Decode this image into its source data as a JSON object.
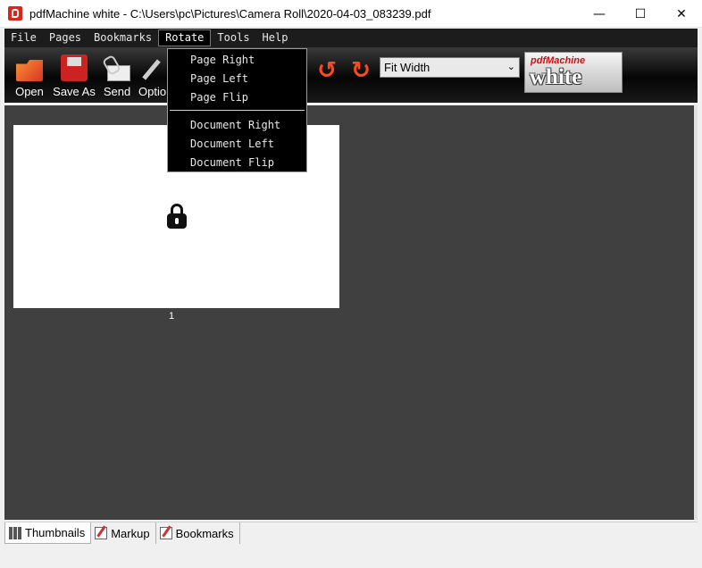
{
  "window": {
    "title": "pdfMachine white - C:\\Users\\pc\\Pictures\\Camera Roll\\2020-04-03_083239.pdf",
    "minimize": "—",
    "maximize": "☐",
    "close": "✕"
  },
  "menubar": {
    "items": [
      {
        "label": "File"
      },
      {
        "label": "Pages"
      },
      {
        "label": "Bookmarks"
      },
      {
        "label": "Rotate"
      },
      {
        "label": "Tools"
      },
      {
        "label": "Help"
      }
    ],
    "active": "Rotate"
  },
  "toolbar": {
    "open_label": "Open",
    "save_as_label": "Save As",
    "send_label": "Send",
    "options_label": "Options",
    "rotate_left_glyph": "↺",
    "rotate_right_glyph": "↻",
    "zoom_value": "Fit Width",
    "logo_top": "pdfMachine",
    "logo_bottom": "white"
  },
  "rotate_menu": {
    "items": [
      {
        "label": "Page Right"
      },
      {
        "label": "Page Left"
      },
      {
        "label": "Page Flip"
      },
      {
        "label": "Document Right"
      },
      {
        "label": "Document Left"
      },
      {
        "label": "Document Flip"
      }
    ]
  },
  "viewer": {
    "page_number": "1"
  },
  "tabs": [
    {
      "label": "Thumbnails",
      "active": true
    },
    {
      "label": "Markup",
      "active": false
    },
    {
      "label": "Bookmarks",
      "active": false
    }
  ],
  "colors": {
    "accent": "#ff4a1a",
    "menu_bg": "#1c1c1c",
    "viewer_bg": "#404040"
  }
}
